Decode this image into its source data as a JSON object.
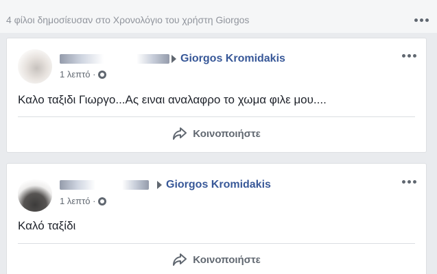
{
  "header": {
    "text": "4 φίλοι δημοσίευσαν στο Χρονολόγιο του χρήστη Giorgos"
  },
  "posts": [
    {
      "target_name": "Giorgos Kromidakis",
      "time": "1 λεπτό ·",
      "text": "Καλο ταξιδι Γιωργο...Ας ειναι αναλαφρο το χωμα φιλε μου....",
      "share_label": "Κοινοποιήστε"
    },
    {
      "target_name": "Giorgos Kromidakis",
      "time": "1 λεπτό ·",
      "text": "Καλό ταξίδι",
      "share_label": "Κοινοποιήστε"
    }
  ],
  "icons": {
    "more": "more-options-icon",
    "audience": "globe-icon",
    "share": "share-arrow-icon",
    "separator": "triangle-right-icon"
  },
  "colors": {
    "link": "#385898",
    "secondary_text": "#606770",
    "background": "#e9ebee",
    "card": "#ffffff"
  }
}
